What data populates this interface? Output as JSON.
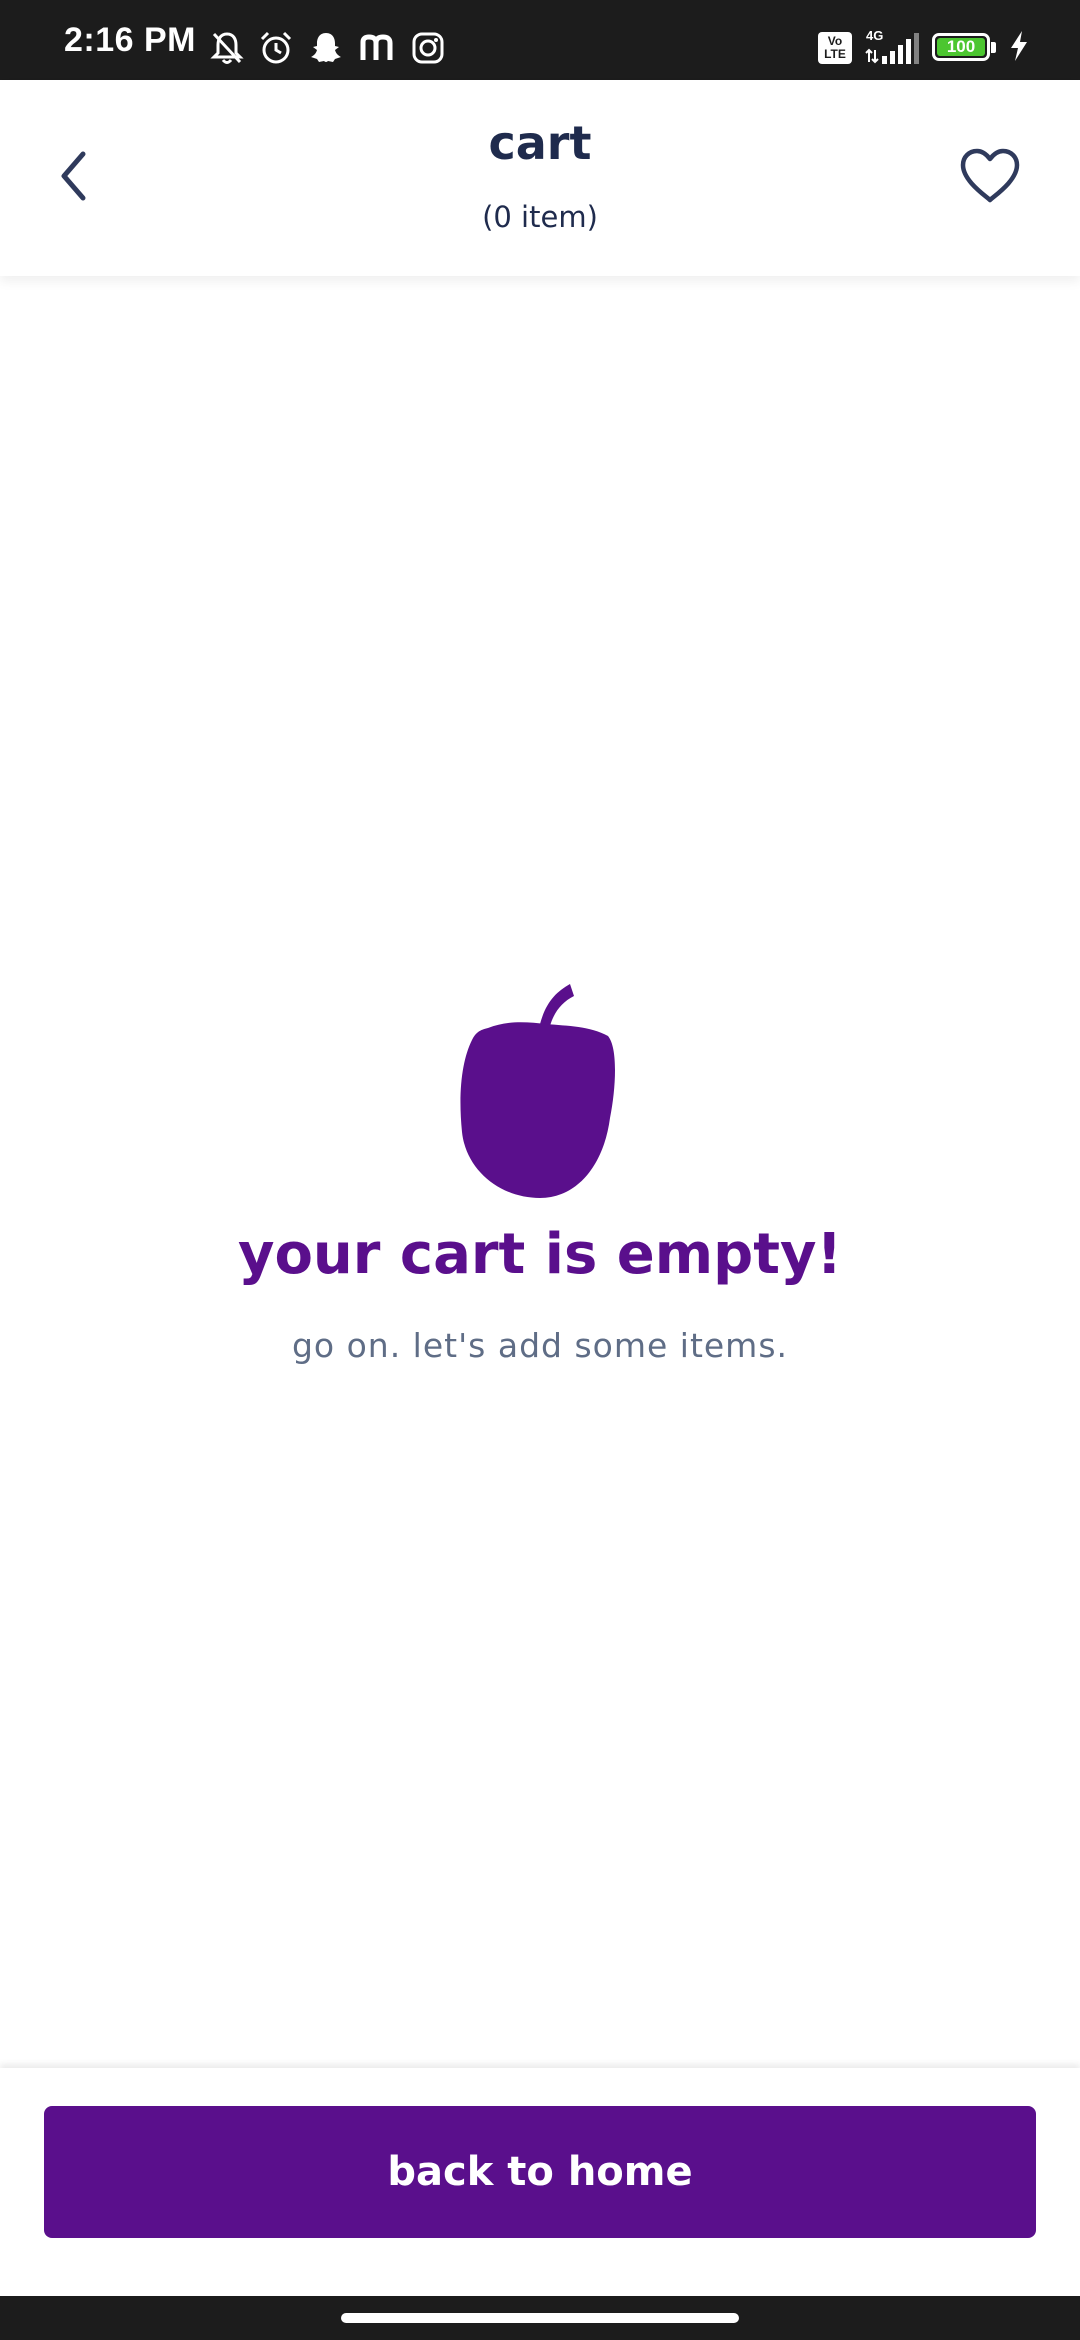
{
  "status_bar": {
    "time": "2:16 PM",
    "left_icons": [
      "bell-muted-icon",
      "alarm-icon",
      "snapchat-icon",
      "m-app-icon",
      "instagram-icon"
    ],
    "volte_label": "Vo LTE",
    "network_label": "4G",
    "battery_level": "100"
  },
  "header": {
    "title": "cart",
    "item_count": "(0 item)"
  },
  "empty_state": {
    "title": "your cart is empty!",
    "subtitle": "go on. let's add some items."
  },
  "footer": {
    "button_label": "back to home"
  },
  "colors": {
    "brand_purple": "#5a0f8c",
    "header_text": "#1f2b4d",
    "subtitle_text": "#5f6d86",
    "battery_green": "#4cc630",
    "system_bar": "#1c1c1c"
  }
}
